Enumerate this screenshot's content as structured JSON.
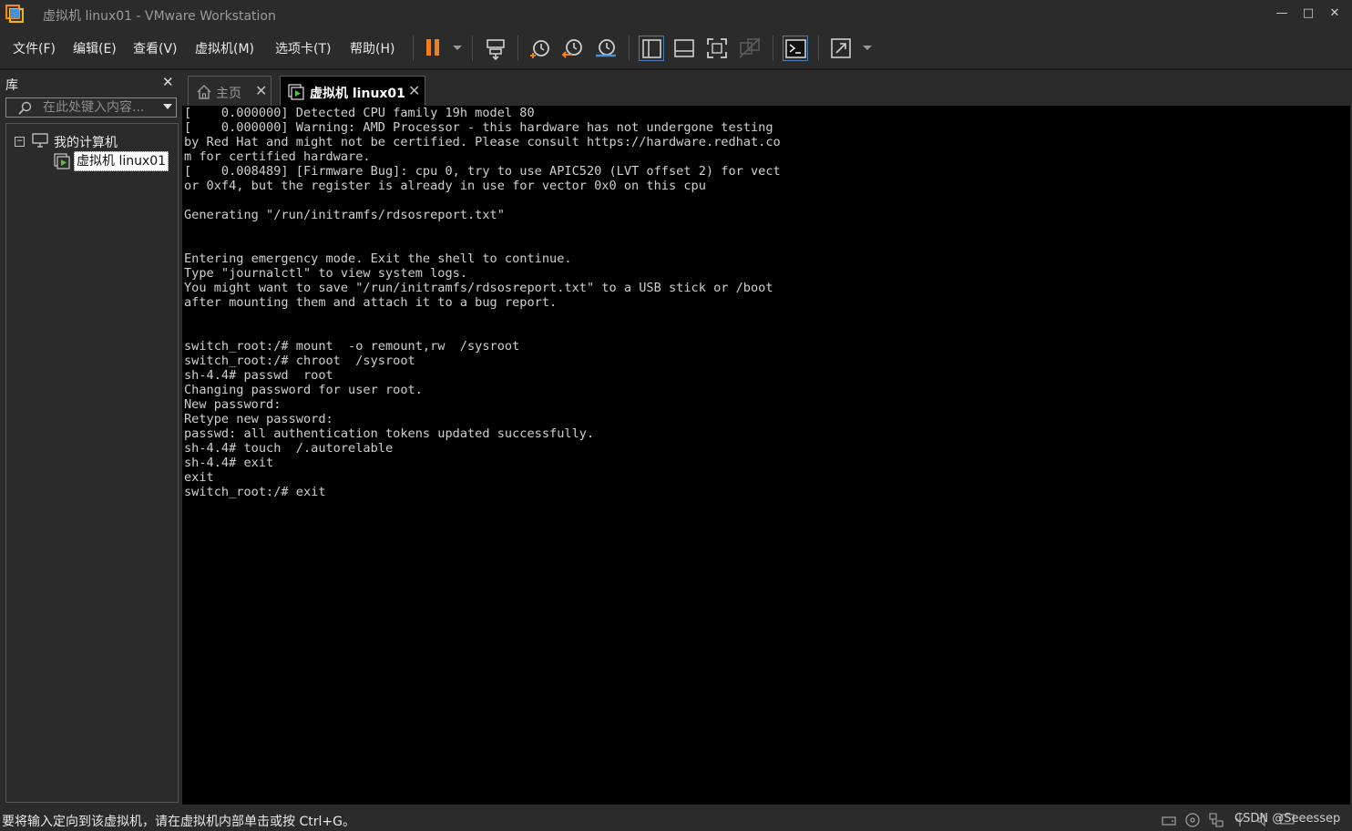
{
  "window": {
    "title": "虚拟机 linux01 - VMware Workstation",
    "controls": {
      "minimize": "—",
      "maximize": "□",
      "close": "✕"
    }
  },
  "menu": {
    "items": [
      {
        "label": "文件(F)"
      },
      {
        "label": "编辑(E)"
      },
      {
        "label": "查看(V)"
      },
      {
        "label": "虚拟机(M)"
      },
      {
        "label": "选项卡(T)"
      },
      {
        "label": "帮助(H)"
      }
    ]
  },
  "toolbar": {
    "buttons": [
      "pause-icon",
      "send-ctrl-alt-del-icon",
      "snapshot-icon",
      "revert-snapshot-icon",
      "snapshot-manager-icon",
      "show-library-icon",
      "thumbnail-bar-icon",
      "full-screen-icon",
      "unity-icon",
      "console-view-icon",
      "stretch-icon"
    ],
    "accent_color": "#f07f1d"
  },
  "library": {
    "title": "库",
    "close": "✕",
    "search_placeholder": "在此处键入内容...",
    "tree": {
      "root_label": "我的计算机",
      "toggle": "−",
      "vm_label": "虚拟机 linux01"
    }
  },
  "tabs": [
    {
      "label": "主页",
      "icon": "home-icon",
      "close": "✕"
    },
    {
      "label": "虚拟机 linux01",
      "icon": "vm-running-icon",
      "close": "✕"
    }
  ],
  "console": {
    "lines": [
      "[    0.000000] Detected CPU family 19h model 80",
      "[    0.000000] Warning: AMD Processor - this hardware has not undergone testing",
      "by Red Hat and might not be certified. Please consult https://hardware.redhat.co",
      "m for certified hardware.",
      "[    0.008489] [Firmware Bug]: cpu 0, try to use APIC520 (LVT offset 2) for vect",
      "or 0xf4, but the register is already in use for vector 0x0 on this cpu",
      "",
      "Generating \"/run/initramfs/rdsosreport.txt\"",
      "",
      "",
      "Entering emergency mode. Exit the shell to continue.",
      "Type \"journalctl\" to view system logs.",
      "You might want to save \"/run/initramfs/rdsosreport.txt\" to a USB stick or /boot",
      "after mounting them and attach it to a bug report.",
      "",
      "",
      "switch_root:/# mount  -o remount,rw  /sysroot",
      "switch_root:/# chroot  /sysroot",
      "sh-4.4# passwd  root",
      "Changing password for user root.",
      "New password:",
      "Retype new password:",
      "passwd: all authentication tokens updated successfully.",
      "sh-4.4# touch  /.autorelable",
      "sh-4.4# exit",
      "exit",
      "switch_root:/# exit"
    ]
  },
  "statusbar": {
    "message": "要将输入定向到该虚拟机，请在虚拟机内部单击或按 Ctrl+G。",
    "watermark": "CSDN @Seeessep",
    "icons": [
      "hard-disk-icon",
      "cd-icon",
      "network-icon",
      "usb-icon",
      "sound-icon",
      "display-icon"
    ]
  }
}
